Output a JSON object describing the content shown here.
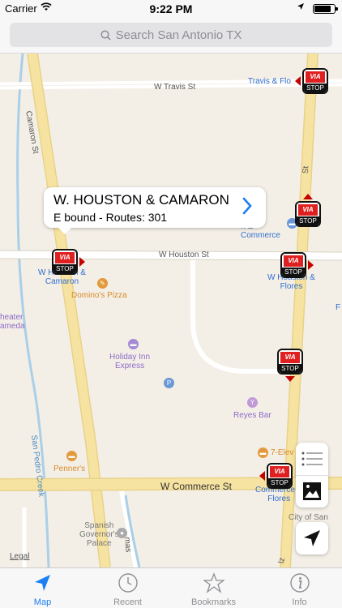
{
  "status_bar": {
    "carrier": "Carrier",
    "time": "9:22 PM"
  },
  "search": {
    "placeholder": "Search San Antonio TX"
  },
  "callout": {
    "title": "W. HOUSTON & CAMARON",
    "subtitle": "E bound - Routes: 301"
  },
  "streets": {
    "w_travis": "W Travis St",
    "camaron": "Camaron St",
    "w_houston": "W Houston St",
    "w_commerce": "W Commerce St",
    "san_pedro_creek": "San Pedro Creek",
    "st_right": "St",
    "mas": "mas",
    "flz": "lz"
  },
  "map_labels": {
    "travis_flores": "Travis & Flo",
    "houston_camaron": "W Houston &\nCamaron",
    "dominos": "Domino's Pizza",
    "holiday_inn": "Holiday Inn\nExpress",
    "reyes_bar": "Reyes Bar",
    "pennnes": "Penner's",
    "seven_eleven": "7-Elev",
    "commerce_flores": "Commerce &\nFlores",
    "houston_flores": "W Houston &\nFlores",
    "tween_commerce": "ween\nn &\nCommerce",
    "theater": "heater\nameda",
    "spanish_gov": "Spanish\nGovernor's\nPalace",
    "city_of_san": "City of San\nA\nCou",
    "edge_f": "F",
    "parking": "P",
    "legal": "Legal"
  },
  "stops": {
    "via": "VIA",
    "stop": "STOP"
  },
  "tabs": [
    {
      "label": "Map",
      "icon": "map-arrow-icon",
      "active": true
    },
    {
      "label": "Recent",
      "icon": "clock-icon",
      "active": false
    },
    {
      "label": "Bookmarks",
      "icon": "star-icon",
      "active": false
    },
    {
      "label": "Info",
      "icon": "info-icon",
      "active": false
    }
  ],
  "colors": {
    "accent": "#1a7ef5",
    "via_red": "#e02020",
    "road_yellow": "#f7e3a1"
  }
}
